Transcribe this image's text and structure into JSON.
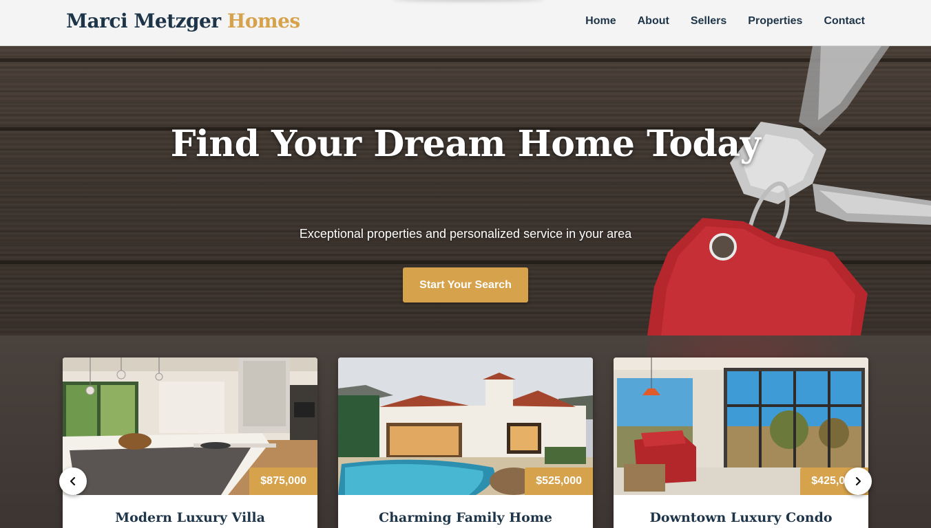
{
  "brand": {
    "name_main": "Marci Metzger",
    "name_accent": "Homes"
  },
  "nav": {
    "items": [
      {
        "label": "Home"
      },
      {
        "label": "About"
      },
      {
        "label": "Sellers"
      },
      {
        "label": "Properties"
      },
      {
        "label": "Contact"
      }
    ]
  },
  "hero": {
    "title": "Find Your Dream Home Today",
    "subtitle": "Exceptional properties and personalized service in your area",
    "cta_label": "Start Your Search"
  },
  "listings": {
    "cards": [
      {
        "price": "$875,000",
        "title": "Modern Luxury Villa",
        "photo_icon": "kitchen-photo"
      },
      {
        "price": "$525,000",
        "title": "Charming Family Home",
        "photo_icon": "pool-house-photo"
      },
      {
        "price": "$425,000",
        "title": "Downtown Luxury Condo",
        "photo_icon": "sunroom-photo"
      }
    ],
    "prev_icon": "chevron-left-icon",
    "next_icon": "chevron-right-icon"
  },
  "colors": {
    "navy": "#1e3448",
    "gold": "#d6a24c",
    "nav_bg": "#f4f4f4"
  }
}
